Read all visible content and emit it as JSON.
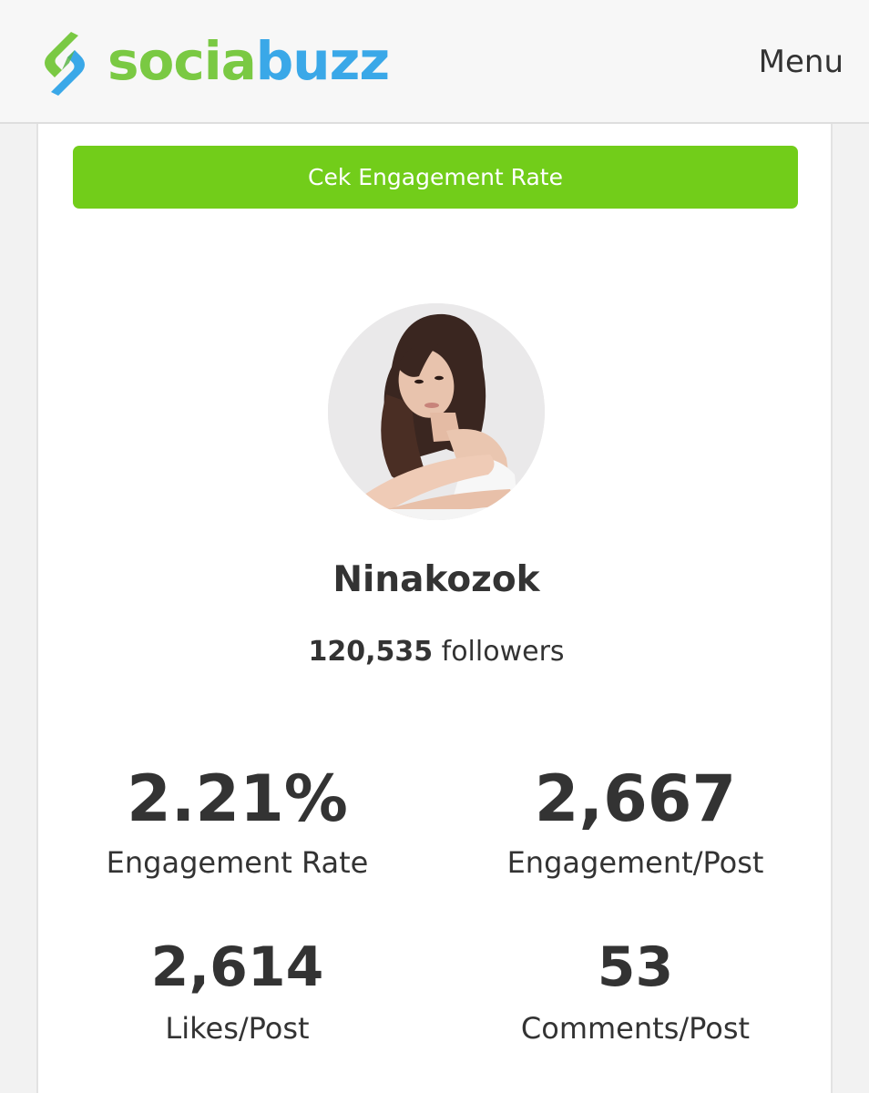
{
  "brand": {
    "name_part1": "socia",
    "name_part2": "buzz",
    "colors": {
      "green": "#7ac943",
      "blue": "#3aa8e8"
    },
    "icon": "sociabuzz-logo-icon"
  },
  "header": {
    "menu_label": "Menu"
  },
  "card": {
    "cta_label": "Cek Engagement Rate",
    "cta_color": "#72cd1a"
  },
  "profile": {
    "username": "Ninakozok",
    "followers_count": "120,535",
    "followers_label": "followers",
    "avatar_icon": "profile-photo"
  },
  "stats": [
    {
      "value": "2.21%",
      "label": "Engagement Rate"
    },
    {
      "value": "2,667",
      "label": "Engagement/Post"
    },
    {
      "value": "2,614",
      "label": "Likes/Post"
    },
    {
      "value": "53",
      "label": "Comments/Post"
    }
  ]
}
